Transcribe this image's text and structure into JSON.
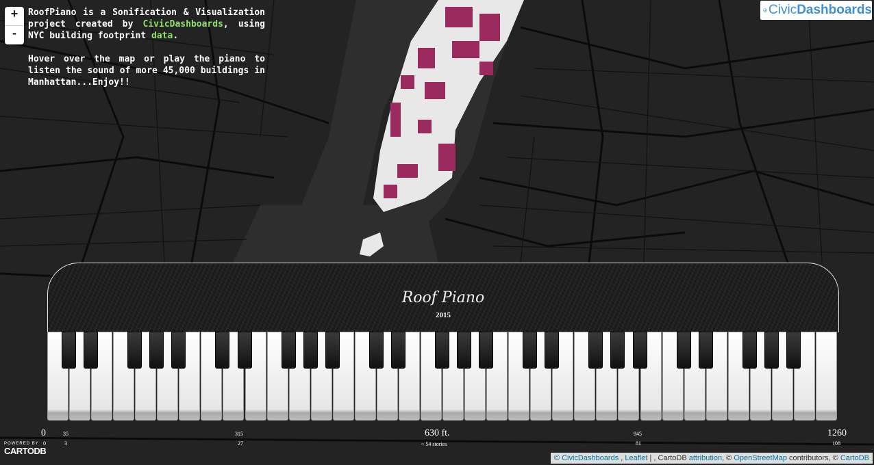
{
  "zoom": {
    "in": "+",
    "out": "-"
  },
  "intro": {
    "p1_before": "RoofPiano is a Sonification & Visualization project created by ",
    "p1_link": "CivicDashboards",
    "p1_mid": ", using NYC building footprint ",
    "p1_data_link": "data",
    "p1_end": ".",
    "p2": "Hover over the map or play the piano to listen the sound of more 45,000 buildings in Manhattan...Enjoy!!"
  },
  "logo": {
    "civic": "Civic",
    "dashboards": "Dashboards",
    "icon": "civicdashboards-logo-icon"
  },
  "piano": {
    "title": "Roof Piano",
    "year": "2015",
    "white_keys": 36,
    "black_keys": 25
  },
  "scale": {
    "l0": "0",
    "s0": "0",
    "l35": "35",
    "s3": "3",
    "l315": "315",
    "s27": "27",
    "l630": "630 ft.",
    "s54": "~ 54 stories",
    "l945": "945",
    "s81": "81",
    "l1260": "1260",
    "s108": "108"
  },
  "branding": {
    "powered": "POWERED BY",
    "name": "CARTODB"
  },
  "attribution": {
    "civic": "© CivicDashboards",
    "sep1": " , ",
    "leaflet": "Leaflet",
    "sep2": " | , CartoDB ",
    "attr_link": "attribution",
    "sep3": ", © ",
    "osm": "OpenStreetMap",
    "sep4": " contributors, © ",
    "cartodb": "CartoDB"
  },
  "colors": {
    "map_bg": "#1e1e1e",
    "water": "#2b2b2b",
    "road": "#0c0c0c",
    "building": "#f2f2f2",
    "tall": "#9b2a5e"
  }
}
